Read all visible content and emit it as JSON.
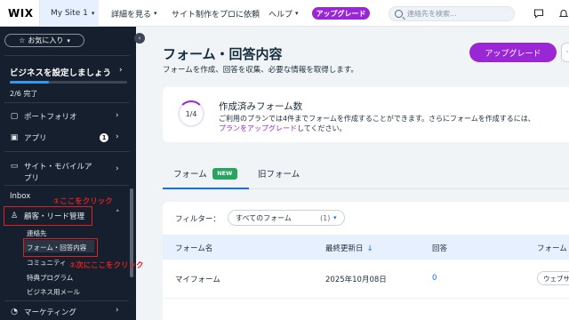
{
  "topbar": {
    "logo": "WIX",
    "site_name": "My Site 1",
    "nav": [
      "詳細を見る",
      "サイト制作をプロに依頼",
      "ヘルプ"
    ],
    "upgrade_label": "アップグレード",
    "search_placeholder": "連絡先を検索..."
  },
  "sidebar": {
    "favorites_label": "お気に入り",
    "setup_title": "ビジネスを設定しましょう",
    "setup_progress_text": "2/6 完了",
    "setup_progress_fraction": 0.333,
    "items": {
      "portfolio": "ポートフォリオ",
      "apps": "アプリ",
      "apps_badge": "1",
      "site_mobile_app_1": "サイト・モバイルア",
      "site_mobile_app_2": "プリ",
      "inbox": "Inbox",
      "crm": "顧客・リード管理",
      "marketing": "マーケティング"
    },
    "sub_items": {
      "contacts": "連絡先",
      "forms": "フォーム・回答内容",
      "community": "コミュニティ",
      "benefits": "特典プログラム",
      "business_email": "ビジネス用メール"
    }
  },
  "annotations": {
    "note1": "①ここをクリック",
    "note2": "②次にここをクリック"
  },
  "main": {
    "title": "フォーム・回答内容",
    "subtitle": "フォームを作成、回答を収集、必要な情報を取得します。",
    "upgrade_button": "アップグレード",
    "card": {
      "ring_label": "1/4",
      "title": "作成済みフォーム数",
      "text": "ご利用のプランでは4件までフォームを作成することができます。さらにフォームを作成するには、",
      "link": "プランをアップグレード",
      "text_end": "してください。"
    },
    "tabs": {
      "forms": "フォーム",
      "new_badge": "NEW",
      "old_forms": "旧フォーム"
    },
    "filter": {
      "label": "フィルター：",
      "value": "すべてのフォーム",
      "count": "(1)"
    },
    "table": {
      "headers": [
        "フォーム名",
        "最終更新日",
        "回答",
        "フォーム"
      ],
      "rows": [
        {
          "name": "マイフォーム",
          "updated": "2025年10月08日",
          "responses": "0",
          "site": "ウェブサ"
        }
      ]
    }
  },
  "colors": {
    "accent": "#116dff",
    "upgrade": "#9a27d5",
    "sidebar_bg": "#151f2d",
    "annotation": "#e02020",
    "new_badge": "#25a55f"
  }
}
